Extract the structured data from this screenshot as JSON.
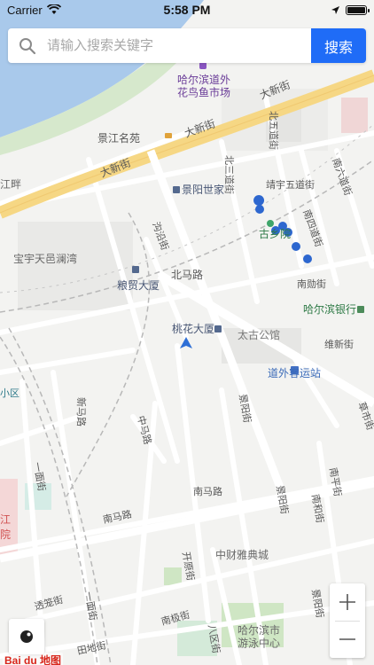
{
  "status_bar": {
    "carrier": "Carrier",
    "time": "5:58 PM"
  },
  "search": {
    "placeholder": "请输入搜索关键字",
    "button_label": "搜索"
  },
  "map": {
    "labels": {
      "market": "哈尔滨道外\n花鸟鱼市场",
      "dax1": "大新街",
      "dax2": "大新街",
      "dax3": "大新街",
      "jingjiang": "景江名苑",
      "beiwu": "北五道街",
      "beisan": "北三道街",
      "jingyang_shijia": "景阳世家",
      "jingyu": "靖宇五道街",
      "nanliu": "南六道街",
      "guxiang": "古乡院",
      "nansi": "南四道街",
      "jinghe": "沟沿街",
      "baoyu": "宝宇天邑澜湾",
      "beima": "北马路",
      "liangmao": "粮贸大厦",
      "nanxun": "南勋街",
      "hrb_bank": "哈尔滨银行",
      "taohua": "桃花大厦",
      "taigu": "太古公馆",
      "weixin": "维新街",
      "daowai_bus": "道外客运站",
      "xiaoqu": "小区",
      "xinmalu": "新马路",
      "jingyang1": "景阳街",
      "zhongmalu": "中马路",
      "caoshi": "草市街",
      "yimian": "一面街",
      "nanmalu": "南马路",
      "jingyang2": "景阳街",
      "nanqi": "南平街",
      "nanmalu2": "南马路",
      "nanhe": "南和街",
      "zhongcai": "中财雅典城",
      "kaiyuan": "开原街",
      "tuolong": "透笼街",
      "yimian2": "一面街",
      "jingyang3": "景阳街",
      "nanji": "南极街",
      "tiandi": "田地街",
      "baqu": "八区街",
      "hrb_swim": "哈尔滨市\n游泳中心",
      "jiang_pan": "江畔",
      "jiang_left": "江",
      "yuan_left": "院"
    }
  },
  "logo": "Bai du 地图"
}
